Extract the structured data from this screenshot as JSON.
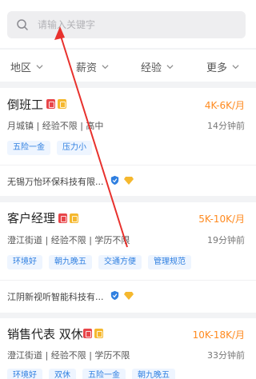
{
  "search": {
    "placeholder": "请输入关键字"
  },
  "filters": [
    {
      "label": "地区"
    },
    {
      "label": "薪资"
    },
    {
      "label": "经验"
    },
    {
      "label": "更多"
    }
  ],
  "jobs": [
    {
      "title": "倒班工",
      "salary": "4K-6K/月",
      "meta": "月城镇 | 经验不限 | 高中",
      "time": "14分钟前",
      "tags": [
        "五险一金",
        "压力小"
      ],
      "company": "无锡万怡环保科技有限..."
    },
    {
      "title": "客户经理",
      "salary": "5K-10K/月",
      "meta": "澄江街道 | 经验不限 | 学历不限",
      "time": "19分钟前",
      "tags": [
        "环境好",
        "朝九晚五",
        "交通方便",
        "管理规范"
      ],
      "company": "江阴新视听智能科技有..."
    },
    {
      "title": "销售代表 双休",
      "salary": "10K-18K/月",
      "meta": "澄江街道 | 经验不限 | 学历不限",
      "time": "33分钟前",
      "tags": [
        "环境好",
        "双休",
        "五险一金",
        "朝九晚五"
      ]
    }
  ],
  "colors": {
    "accent": "#2f7fe0",
    "salary": "#ff8a1f",
    "annotation": "#e8312d"
  }
}
